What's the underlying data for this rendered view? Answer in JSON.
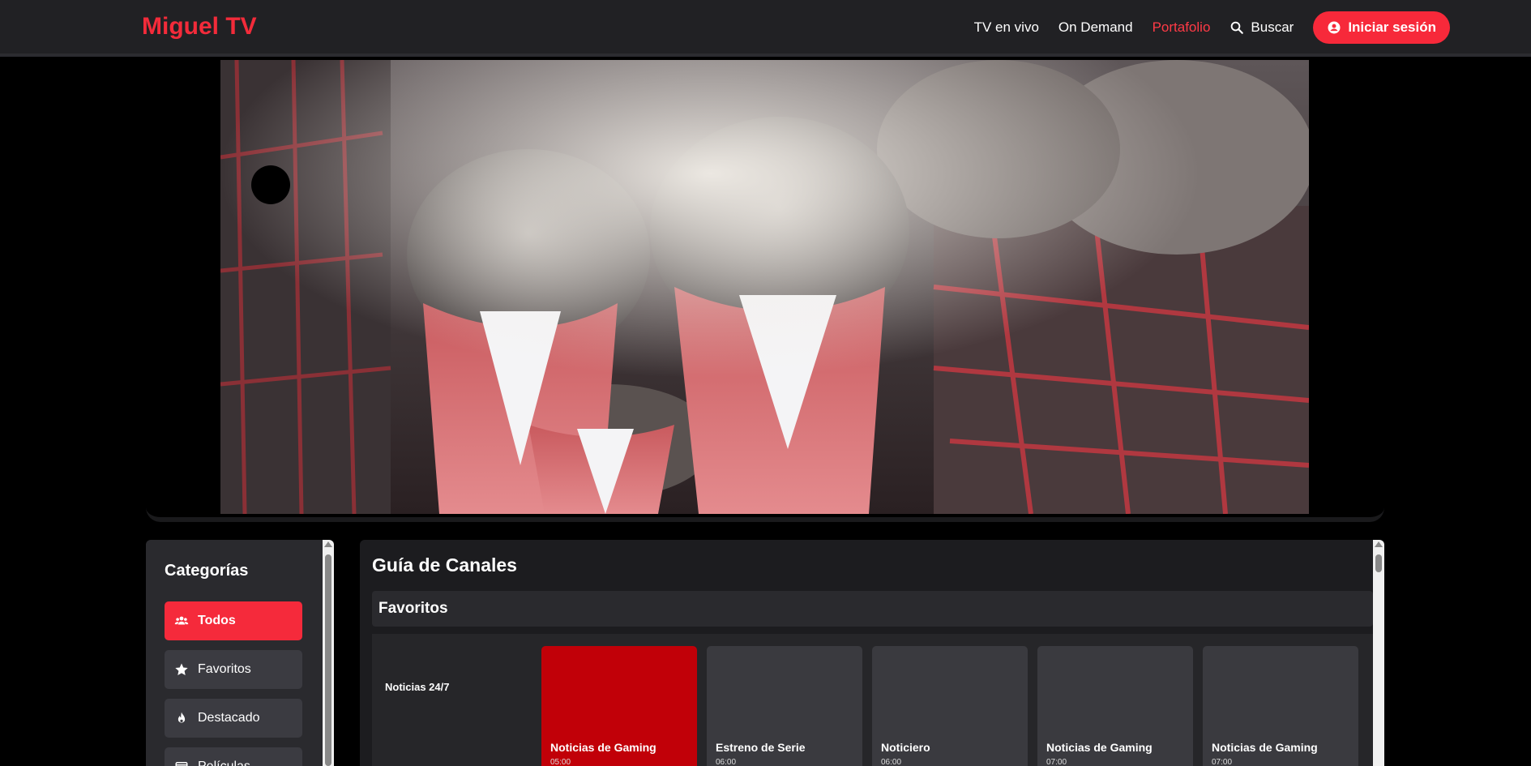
{
  "header": {
    "logo": "Miguel TV",
    "nav": [
      {
        "label": "TV en vivo",
        "active": false
      },
      {
        "label": "On Demand",
        "active": false
      },
      {
        "label": "Portafolio",
        "active": true
      }
    ],
    "search_label": "Buscar",
    "search_icon": "search-icon",
    "login_label": "Iniciar sesión",
    "login_icon": "user-circle-icon",
    "accent_color": "#f7293a"
  },
  "sidebar": {
    "title": "Categorías",
    "items": [
      {
        "label": "Todos",
        "icon": "users-icon",
        "active": true
      },
      {
        "label": "Favoritos",
        "icon": "star-icon",
        "active": false
      },
      {
        "label": "Destacado",
        "icon": "fire-icon",
        "active": false
      },
      {
        "label": "Películas",
        "icon": "film-icon",
        "active": false
      }
    ]
  },
  "guide": {
    "title": "Guía de Canales",
    "section": "Favoritos",
    "channel": "Noticias 24/7",
    "programs": [
      {
        "title": "Noticias de Gaming",
        "time": "05:00",
        "active": true
      },
      {
        "title": "Estreno de Serie",
        "time": "06:00",
        "active": false
      },
      {
        "title": "Noticiero",
        "time": "06:00",
        "active": false
      },
      {
        "title": "Noticias de Gaming",
        "time": "07:00",
        "active": false
      },
      {
        "title": "Noticias de Gaming",
        "time": "07:00",
        "active": false
      }
    ]
  }
}
